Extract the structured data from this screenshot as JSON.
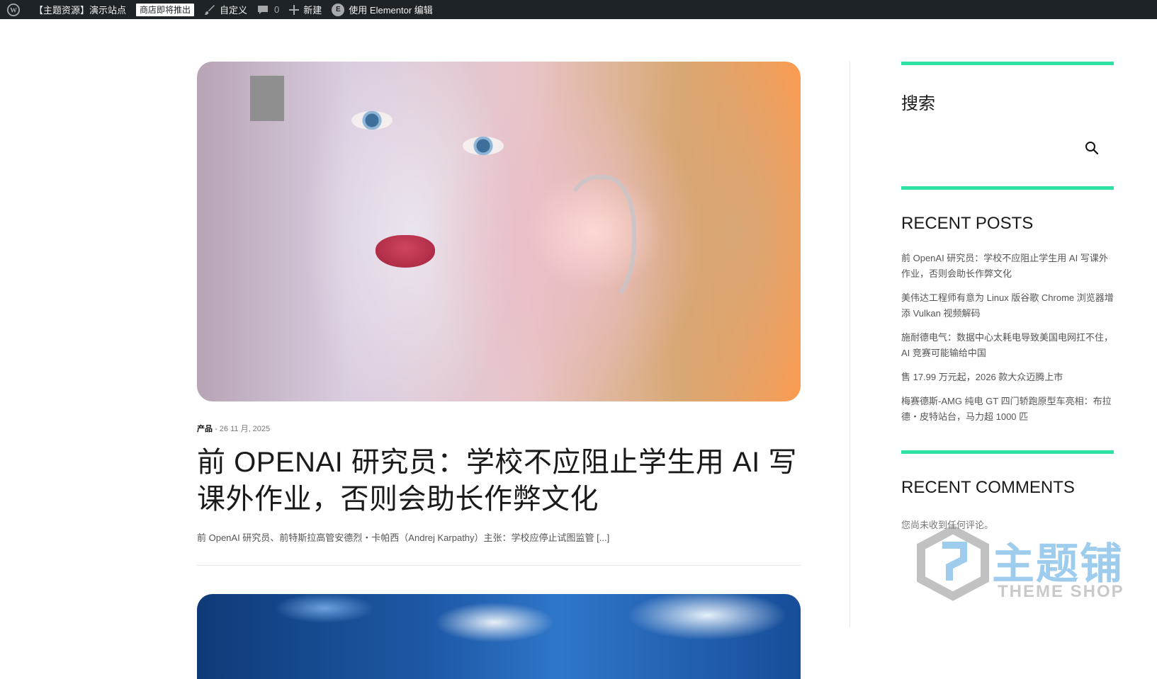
{
  "adminbar": {
    "site_name": "【主题资源】演示站点",
    "store_badge": "商店即将推出",
    "customize": "自定义",
    "comments_count": "0",
    "new": "新建",
    "elementor": "使用 Elementor 编辑"
  },
  "post": {
    "category": "产品",
    "date": "26 11 月, 2025",
    "title": "前 OPENAI 研究员：学校不应阻止学生用 AI 写课外作业，否则会助长作弊文化",
    "excerpt": "前 OpenAI 研究员、前特斯拉高管安德烈・卡帕西（Andrej Karpathy）主张：学校应停止试图监管 [...]"
  },
  "sidebar": {
    "search_title": "搜索",
    "search_placeholder": "",
    "recent_posts_title": "RECENT POSTS",
    "recent_posts": [
      "前 OpenAI 研究员：学校不应阻止学生用 AI 写课外作业，否则会助长作弊文化",
      "美伟达工程师有意为 Linux 版谷歌 Chrome 浏览器增添 Vulkan 视频解码",
      "施耐德电气：数据中心太耗电导致美国电网扛不住，AI 竞赛可能输给中国",
      "售 17.99 万元起，2026 款大众迈腾上市",
      "梅赛德斯-AMG 纯电 GT 四门轿跑原型车亮相：布拉德・皮特站台，马力超 1000 匹"
    ],
    "recent_comments_title": "RECENT COMMENTS",
    "no_comments": "您尚未收到任何评论。"
  },
  "watermark": {
    "cn": "主题铺",
    "en": "THEME SHOP"
  },
  "colors": {
    "accent": "#2de3a4",
    "adminbar_bg": "#1d2327"
  }
}
